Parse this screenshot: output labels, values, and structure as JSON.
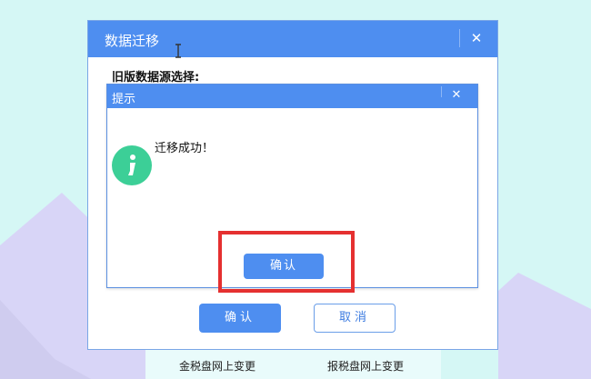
{
  "outer_dialog": {
    "title": "数据迁移",
    "close_label": "✕",
    "source_label": "旧版数据源选择:",
    "ok_label": "确认",
    "cancel_label": "取消"
  },
  "prompt_dialog": {
    "title": "提示",
    "close_label": "✕",
    "message": "迁移成功！",
    "ok_label": "确认",
    "icon": "info-icon"
  },
  "bottom_links": [
    "金税盘网上变更",
    "报税盘网上变更"
  ],
  "colors": {
    "background": "#d5f7f5",
    "mountain": "#d8d5f7",
    "titlebar": "#4e8ef0",
    "info_icon": "#3ccf97",
    "highlight": "#e53030"
  }
}
